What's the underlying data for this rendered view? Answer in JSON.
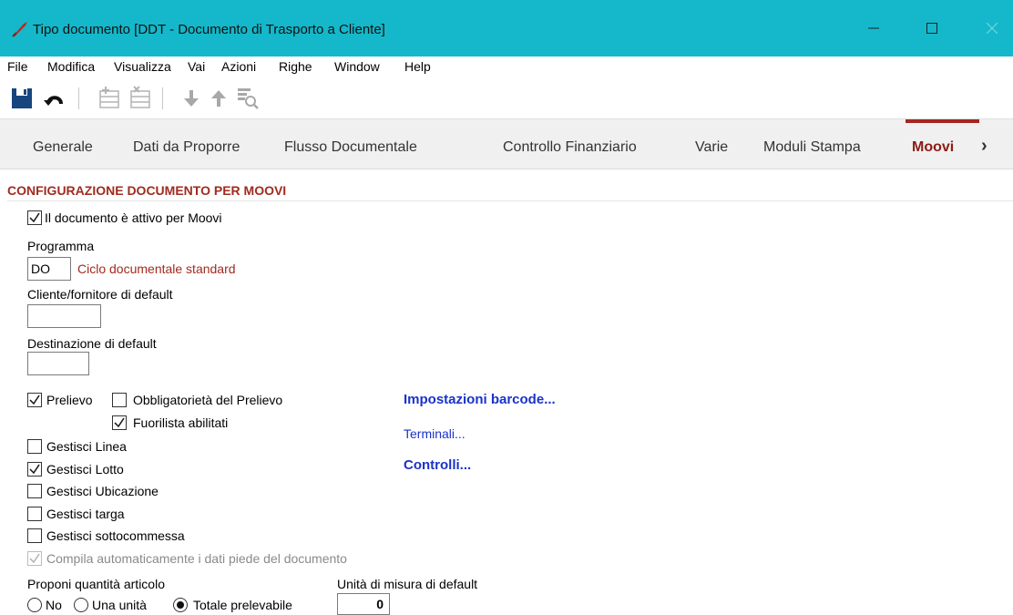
{
  "window": {
    "title": "Tipo documento [DDT - Documento di Trasporto a Cliente]",
    "accent": "#14b8ca"
  },
  "menu": {
    "items": [
      "File",
      "Modifica",
      "Visualizza",
      "Vai",
      "Azioni",
      "Righe",
      "Window",
      "Help"
    ]
  },
  "toolbar": {
    "icons": [
      "save-icon",
      "undo-icon",
      "insert-row-icon",
      "delete-row-icon",
      "move-down-icon",
      "move-up-icon",
      "preview-icon"
    ]
  },
  "tabs": {
    "items": [
      "Generale",
      "Dati da Proporre",
      "Flusso Documentale",
      "Controllo Finanziario",
      "Varie",
      "Moduli Stampa",
      "Moovi"
    ],
    "active": "Moovi",
    "more_glyph": "›"
  },
  "section": {
    "title": "CONFIGURAZIONE DOCUMENTO PER MOOVI"
  },
  "form": {
    "attivo_label": "Il documento è attivo per Moovi",
    "attivo_checked": true,
    "programma_label": "Programma",
    "programma_value": "DO",
    "programma_desc": "Ciclo documentale standard",
    "cliente_label": "Cliente/fornitore di default",
    "cliente_value": "",
    "destinazione_label": "Destinazione di default",
    "destinazione_value": "",
    "prelievo_label": "Prelievo",
    "obbligatorieta_label": "Obbligatorietà del Prelievo",
    "fuorilista_label": "Fuorilista abilitati",
    "gestisci_linea_label": "Gestisci Linea",
    "gestisci_lotto_label": "Gestisci Lotto",
    "gestisci_ubicazione_label": "Gestisci Ubicazione",
    "gestisci_targa_label": "Gestisci targa",
    "gestisci_sottocommessa_label": "Gestisci sottocommessa",
    "compila_label": "Compila automaticamente i dati piede del documento",
    "proponi_label": "Proponi quantità articolo",
    "radio_no": "No",
    "radio_una": "Una unità",
    "radio_totale": "Totale prelevabile",
    "radio_selected": "Totale prelevabile",
    "um_label": "Unità di misura di default",
    "um_value": "0"
  },
  "links": {
    "barcode": "Impostazioni barcode...",
    "terminali": "Terminali...",
    "controlli": "Controlli..."
  }
}
